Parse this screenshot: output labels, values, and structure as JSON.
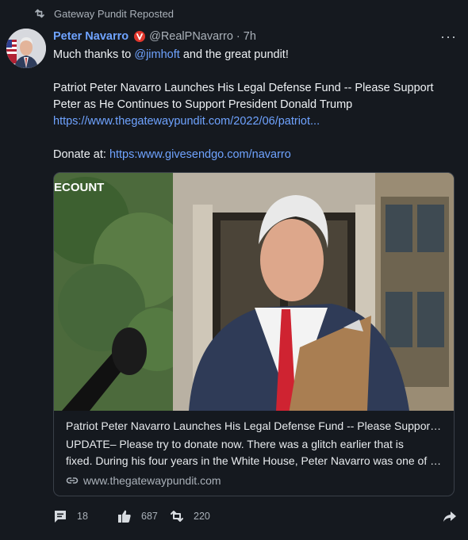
{
  "repost": {
    "label": "Gateway Pundit Reposted",
    "icon": "repost-icon"
  },
  "post": {
    "author_name": "Peter Navarro",
    "handle": "@RealPNavarro",
    "separator": "·",
    "time": "7h",
    "more_label": "···",
    "lines": {
      "l1_pre": "Much thanks to ",
      "l1_mention": "@jimhoft",
      "l1_post": " and the great pundit!",
      "l3": "Patriot Peter Navarro Launches His Legal Defense Fund -- Please Support",
      "l4": "Peter as He Continues to Support President Donald Trump",
      "l5_link": "https://www.thegatewaypundit.com/2022/06/patriot...",
      "l7_pre": "Donate at: ",
      "l7_link": "https:www.givesendgo.com/navarro"
    }
  },
  "card": {
    "image_label": "ECOUNT",
    "title": "Patriot Peter Navarro Launches His Legal Defense Fund -- Please Support Peter as He Continues to Support President Donald Trump",
    "desc_line1": "UPDATE–  Please try to donate now.  There was a glitch earlier that is",
    "desc_line2": "fixed. During his four years in the White House, Peter Navarro was one of the most effective",
    "domain": "www.thegatewaypundit.com",
    "domain_icon": "link-icon"
  },
  "actions": {
    "replies": "18",
    "likes": "687",
    "reposts": "220"
  },
  "colors": {
    "background": "#15191f",
    "accent_link": "#6fa3ff",
    "muted": "#aab1b9",
    "verified": "#e0362c"
  }
}
